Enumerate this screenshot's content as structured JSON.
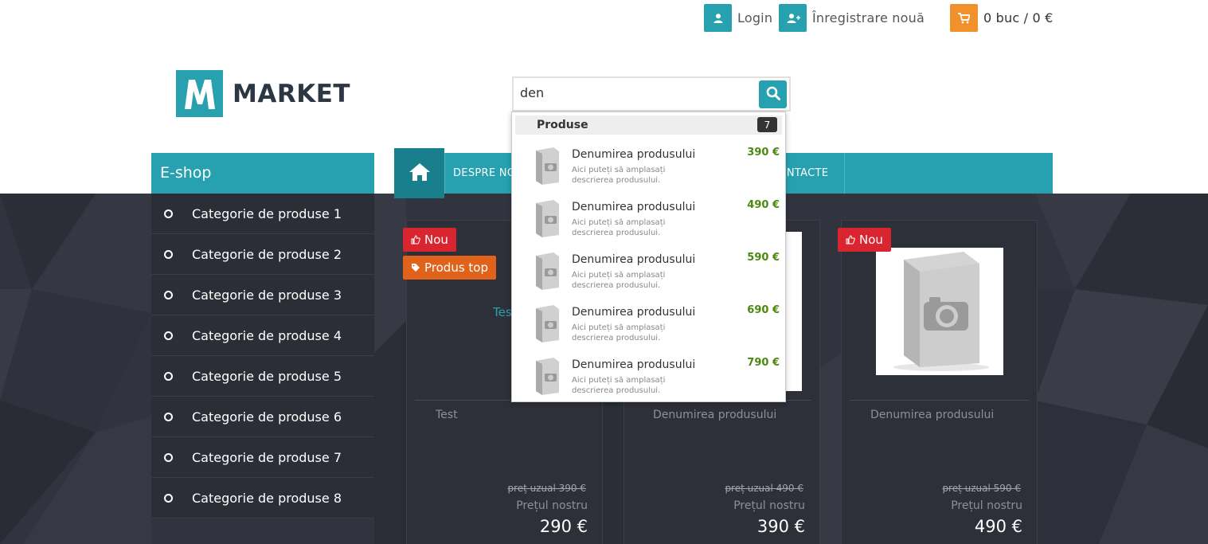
{
  "topbar": {
    "login_label": "Login",
    "register_label": "Înregistrare nouă",
    "cart_label": "0 buc / 0 €",
    "accent": "#27a1b0",
    "cart_color": "#f0912b"
  },
  "logo": {
    "text": "MARKET",
    "mark": "M"
  },
  "search": {
    "value": "den",
    "placeholder": ""
  },
  "nav": {
    "eshop_title": "E-shop",
    "items": [
      "DESPRE NOI",
      "CONTACTE"
    ]
  },
  "categories": [
    "Categorie de produse 1",
    "Categorie de produse 2",
    "Categorie de produse 3",
    "Categorie de produse 4",
    "Categorie de produse 5",
    "Categorie de produse 6",
    "Categorie de produse 7",
    "Categorie de produse 8"
  ],
  "badges": {
    "new": "Nou",
    "top": "Produs top"
  },
  "products": [
    {
      "name": "Test",
      "link_text": "Tes",
      "old_price": "preț uzual 390 €",
      "our_label": "Prețul nostru",
      "price": "290 €"
    },
    {
      "name": "Denumirea produsului",
      "old_price": "preț uzual 490 €",
      "our_label": "Prețul nostru",
      "price": "390 €"
    },
    {
      "name": "Denumirea produsului",
      "old_price": "preț uzual 590 €",
      "our_label": "Prețul nostru",
      "price": "490 €"
    }
  ],
  "suggestions": {
    "heading": "Produse",
    "count": "7",
    "items": [
      {
        "name": "Denumirea produsului",
        "desc": "Aici puteți să amplasați descrierea produsului.",
        "price": "390 €"
      },
      {
        "name": "Denumirea produsului",
        "desc": "Aici puteți să amplasați descrierea produsului.",
        "price": "490 €"
      },
      {
        "name": "Denumirea produsului",
        "desc": "Aici puteți să amplasați descrierea produsului.",
        "price": "590 €"
      },
      {
        "name": "Denumirea produsului",
        "desc": "Aici puteți să amplasați descrierea produsului.",
        "price": "690 €"
      },
      {
        "name": "Denumirea produsului",
        "desc": "Aici puteți să amplasați descrierea produsului.",
        "price": "790 €"
      }
    ]
  }
}
